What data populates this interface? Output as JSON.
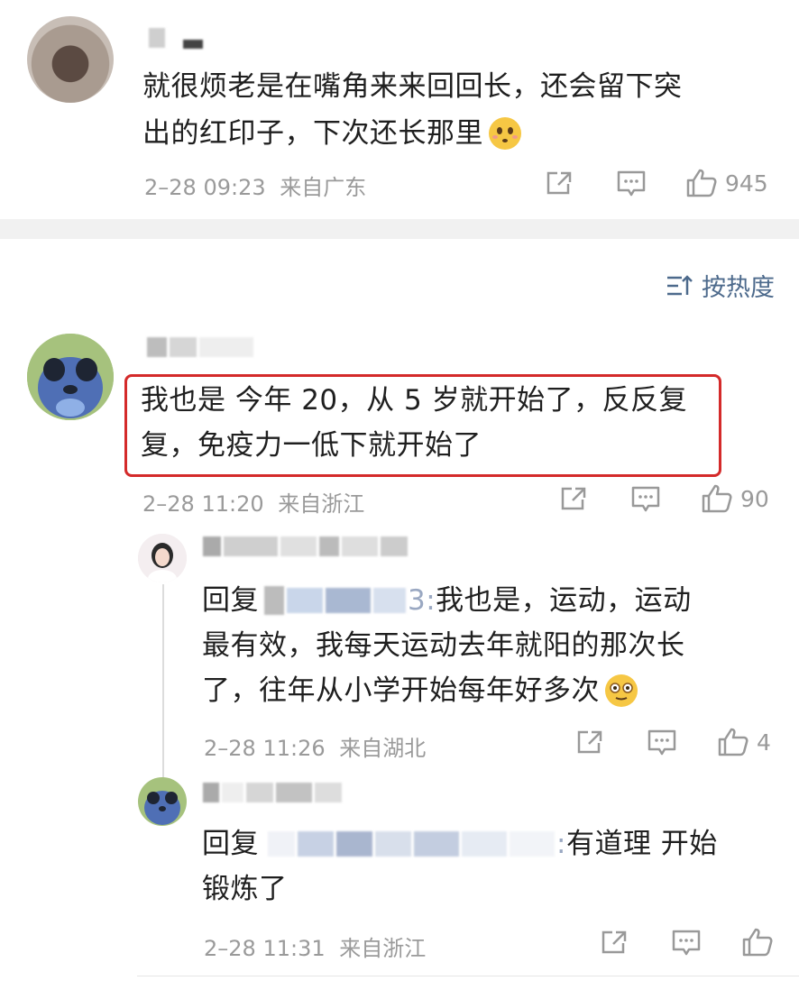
{
  "comments": [
    {
      "text_lines": [
        "就很烦老是在嘴角来来回回长，还会留下突",
        "出的红印子，下次还长那里"
      ],
      "date": "2–28 09:23",
      "location": "来自广东",
      "likes": "945"
    },
    {
      "text_lines": [
        "我也是 今年 20，从 5 岁就开始了，反反复",
        "复，免疫力一低下就开始了"
      ],
      "date": "2–28 11:20",
      "location": "来自浙江",
      "likes": "90"
    }
  ],
  "sort": {
    "label": "按热度"
  },
  "replies": [
    {
      "prefix": "回复",
      "mention_tail": "3:",
      "text_lines": [
        "我也是，运动，运动",
        "最有效，我每天运动去年就阳的那次长",
        "了，往年从小学开始每年好多次"
      ],
      "date": "2–28 11:26",
      "location": "来自湖北",
      "likes": "4"
    },
    {
      "prefix": "回复",
      "mention_tail": ":",
      "text_lines": [
        "有道理 开始",
        "锻炼了"
      ],
      "date": "2–28 11:31",
      "location": "来自浙江",
      "likes": ""
    }
  ],
  "colors": {
    "highlight": "#d42a2a",
    "link": "#4d6a8c",
    "meta": "#9a9a9a"
  },
  "icons": [
    "share-icon",
    "comment-icon",
    "like-icon",
    "sort-icon",
    "emoji-icon"
  ]
}
